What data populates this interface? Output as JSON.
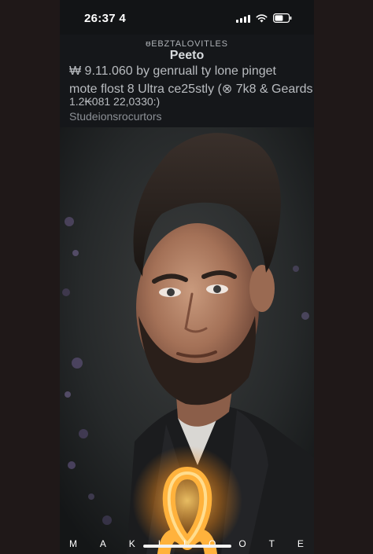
{
  "status_bar": {
    "time": "26:37 4"
  },
  "header": {
    "eyebrow": "ᵿEBZTALOVITLES",
    "title": "Peeto",
    "line1": "₩ 9.11.060 by genruall ty lone pinget",
    "line2": "mote flost 8 Ultra ce25stly (⊗ 7k8 & Geards",
    "line3": "1.2₭081 22,0330:)",
    "subtitle": "Studeionsrocurtors"
  },
  "brand": {
    "letters": [
      "M",
      "A",
      "K",
      "I",
      "I",
      "O",
      "O",
      "T",
      "E"
    ]
  },
  "icons": {
    "signal": "cellular-signal-icon",
    "wifi": "wifi-icon",
    "battery": "battery-icon",
    "ribbon": "glowing-ribbon-icon"
  },
  "colors": {
    "background": "#1e1818",
    "header_bg": "#15171a",
    "ribbon_glow": "#f59a2a"
  }
}
